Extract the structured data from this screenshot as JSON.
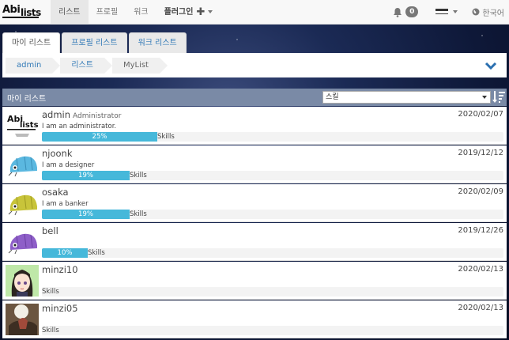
{
  "app": {
    "logo_top": "Abi",
    "logo_bottom": "lists"
  },
  "nav": {
    "items": [
      {
        "label": "리스트",
        "active": true
      },
      {
        "label": "프로필",
        "active": false
      },
      {
        "label": "워크",
        "active": false
      }
    ],
    "plugin_label": "플러그인",
    "notification_count": "0",
    "language_label": "한국어"
  },
  "tabs": [
    {
      "label": "마이 리스트",
      "active": true
    },
    {
      "label": "프로필 리스트",
      "active": false
    },
    {
      "label": "워크 리스트",
      "active": false
    }
  ],
  "breadcrumb": [
    {
      "label": "admin",
      "link": true
    },
    {
      "label": "리스트",
      "link": true
    },
    {
      "label": "MyList",
      "link": false
    }
  ],
  "list": {
    "title": "마이 리스트",
    "sort_select_value": "스킬",
    "rows": [
      {
        "name": "admin",
        "role": "Administrator",
        "date": "2020/02/07",
        "desc": "I am an administrator.",
        "progress": 25,
        "progress_label": "25%",
        "bar_label": "Skills",
        "avatar": "logo-avatar"
      },
      {
        "name": "njoonk",
        "role": "",
        "date": "2019/12/12",
        "desc": "I am a designer",
        "progress": 19,
        "progress_label": "19%",
        "bar_label": "Skills",
        "avatar": "bug-avatar-blue"
      },
      {
        "name": "osaka",
        "role": "",
        "date": "2020/02/09",
        "desc": "I am a banker",
        "progress": 19,
        "progress_label": "19%",
        "bar_label": "Skills",
        "avatar": "bug-avatar-yellow"
      },
      {
        "name": "bell",
        "role": "",
        "date": "2019/12/26",
        "desc": "",
        "progress": 10,
        "progress_label": "10%",
        "bar_label": "Skills",
        "avatar": "bug-avatar-purple"
      },
      {
        "name": "minzi10",
        "role": "",
        "date": "2020/02/13",
        "desc": "",
        "progress": 0,
        "progress_label": "",
        "bar_label": "Skills",
        "avatar": "anime-avatar"
      },
      {
        "name": "minzi05",
        "role": "",
        "date": "2020/02/13",
        "desc": "",
        "progress": 0,
        "progress_label": "",
        "bar_label": "Skills",
        "avatar": "photo-avatar"
      }
    ]
  },
  "colors": {
    "progress": "#46b8da",
    "header": "#7a8aa6",
    "link": "#337ab7"
  }
}
